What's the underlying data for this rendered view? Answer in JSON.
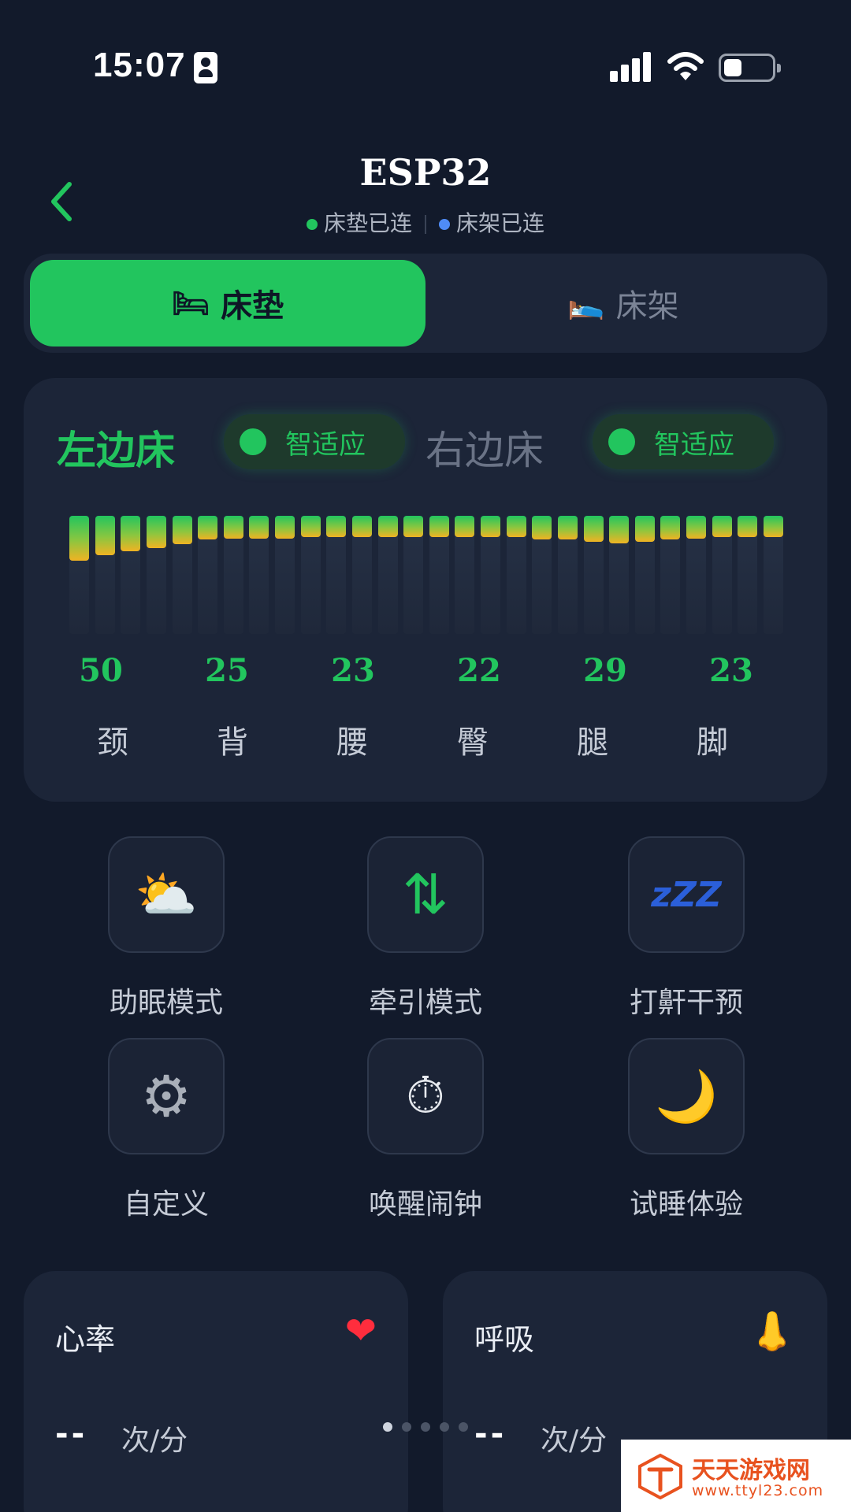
{
  "status_bar": {
    "time": "15:07"
  },
  "header": {
    "title": "ESP32",
    "mattress_status": "床垫已连",
    "frame_status": "床架已连",
    "colors": {
      "mattress_dot": "#22c55e",
      "frame_dot": "#4f8cf7"
    }
  },
  "tabs": [
    {
      "label": "床垫",
      "icon": "bed-icon",
      "active": true
    },
    {
      "label": "床架",
      "icon": "sleeping-person-icon",
      "active": false
    }
  ],
  "bed": {
    "left_label": "左边床",
    "right_label": "右边床",
    "left_mode": "智适应",
    "right_mode": "智适应",
    "firmness_levels": [
      0.38,
      0.33,
      0.3,
      0.27,
      0.24,
      0.2,
      0.19,
      0.19,
      0.19,
      0.18,
      0.18,
      0.18,
      0.18,
      0.18,
      0.18,
      0.18,
      0.18,
      0.18,
      0.2,
      0.2,
      0.22,
      0.23,
      0.22,
      0.2,
      0.19,
      0.18,
      0.18,
      0.18
    ],
    "zones": [
      {
        "value": "50",
        "label": "颈"
      },
      {
        "value": "25",
        "label": "背"
      },
      {
        "value": "23",
        "label": "腰"
      },
      {
        "value": "22",
        "label": "臀"
      },
      {
        "value": "29",
        "label": "腿"
      },
      {
        "value": "23",
        "label": "脚"
      }
    ]
  },
  "features": [
    {
      "label": "助眠模式",
      "icon": "sun-behind-cloud-icon",
      "glyph": "⛅"
    },
    {
      "label": "牵引模式",
      "icon": "up-down-arrows-icon",
      "glyph": "⇅"
    },
    {
      "label": "打鼾干预",
      "icon": "zzz-icon",
      "glyph": "zZZ"
    },
    {
      "label": "自定义",
      "icon": "gear-icon",
      "glyph": "⚙"
    },
    {
      "label": "唤醒闹钟",
      "icon": "stopwatch-icon",
      "glyph": "⏱"
    },
    {
      "label": "试睡体验",
      "icon": "crescent-moon-icon",
      "glyph": "🌙"
    }
  ],
  "vitals": [
    {
      "title": "心率",
      "value": "--",
      "unit": "次/分",
      "icon": "heart-icon",
      "glyph": "❤"
    },
    {
      "title": "呼吸",
      "value": "--",
      "unit": "次/分",
      "icon": "nose-icon",
      "glyph": "👃"
    }
  ],
  "pager": {
    "count": 5,
    "active_index": 0
  },
  "watermark": {
    "name": "天天游戏网",
    "url": "www.ttyl23.com"
  }
}
